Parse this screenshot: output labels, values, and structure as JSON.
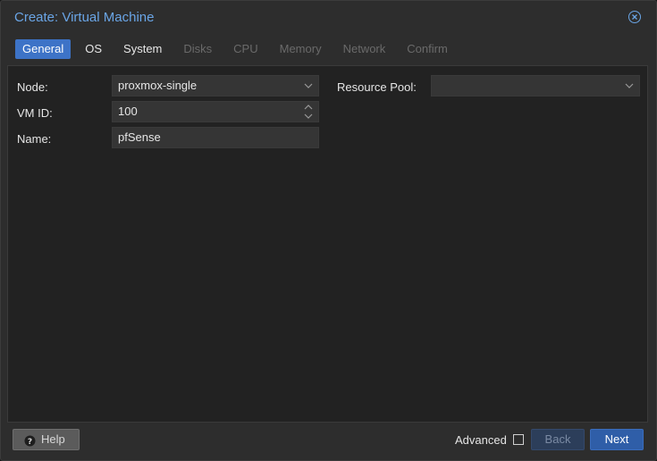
{
  "window": {
    "title": "Create: Virtual Machine"
  },
  "tabs": [
    {
      "label": "General",
      "state": "active"
    },
    {
      "label": "OS",
      "state": "enabled"
    },
    {
      "label": "System",
      "state": "enabled"
    },
    {
      "label": "Disks",
      "state": "disabled"
    },
    {
      "label": "CPU",
      "state": "disabled"
    },
    {
      "label": "Memory",
      "state": "disabled"
    },
    {
      "label": "Network",
      "state": "disabled"
    },
    {
      "label": "Confirm",
      "state": "disabled"
    }
  ],
  "form": {
    "node": {
      "label": "Node:",
      "value": "proxmox-single"
    },
    "vmid": {
      "label": "VM ID:",
      "value": "100"
    },
    "name": {
      "label": "Name:",
      "value": "pfSense"
    },
    "pool": {
      "label": "Resource Pool:",
      "value": ""
    }
  },
  "footer": {
    "help_label": "Help",
    "advanced_label": "Advanced",
    "advanced_checked": false,
    "back_label": "Back",
    "next_label": "Next"
  },
  "colors": {
    "accent": "#3d73c7",
    "title": "#6aa5e6",
    "background": "#2d2d2d",
    "panel": "#222222"
  },
  "icons": {
    "close": "close-circle-icon",
    "help": "question-circle-icon",
    "dropdown": "chevron-down-icon",
    "spinner": "spinner-arrows-icon"
  }
}
